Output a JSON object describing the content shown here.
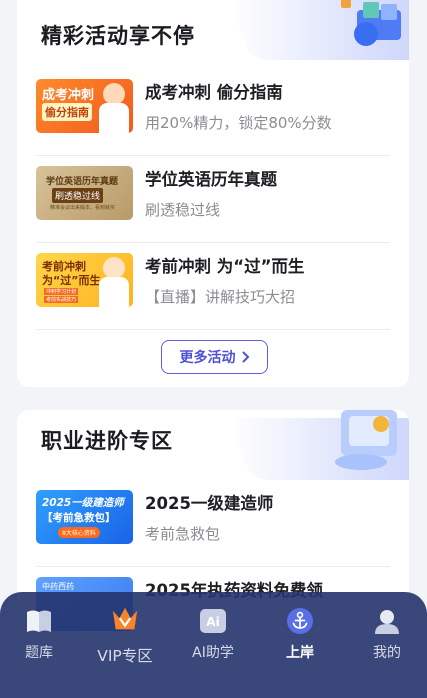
{
  "activities": {
    "title": "精彩活动享不停",
    "items": [
      {
        "title": "成考冲刺 偷分指南",
        "subtitle": "用20%精力，锁定80%分数",
        "thumb_line1": "成考冲刺",
        "thumb_line2": "偷分指南"
      },
      {
        "title": "学位英语历年真题",
        "subtitle": "刷透稳过线",
        "thumb_line1": "学位英语历年真题",
        "thumb_line2": "刷透稳过线",
        "thumb_line3": "精准会议出来版本，看到就买"
      },
      {
        "title": "考前冲刺 为“过”而生",
        "subtitle": "【直播】讲解技巧大招",
        "thumb_line1": "考前冲刺",
        "thumb_line2": "为“过”而生",
        "thumb_line3": "冲刺学习计划",
        "thumb_line4": "考前实战技巧"
      }
    ],
    "more_label": "更多活动"
  },
  "career": {
    "title": "职业进阶专区",
    "items": [
      {
        "title": "2025一级建造师",
        "subtitle": "考前急救包",
        "thumb_line1": "2025一级建造师",
        "thumb_line2": "【考前急救包】",
        "thumb_line3": "8大核心资料"
      },
      {
        "title": "2025年执药资料免费领",
        "subtitle": "",
        "thumb_line1": "中药西药"
      }
    ]
  },
  "tabbar": {
    "tabs": [
      {
        "label": "题库",
        "icon": "book-icon"
      },
      {
        "label": "VIP专区",
        "icon": "vip-crown-icon"
      },
      {
        "label": "AI助学",
        "icon": "ai-icon"
      },
      {
        "label": "上岸",
        "icon": "anchor-icon",
        "active": true
      },
      {
        "label": "我的",
        "icon": "person-icon"
      }
    ]
  },
  "colors": {
    "accent": "#4d51d6",
    "tabbar_bg": "#24336c",
    "orange": "#f7832b",
    "active_icon": "#5a6ee6"
  }
}
